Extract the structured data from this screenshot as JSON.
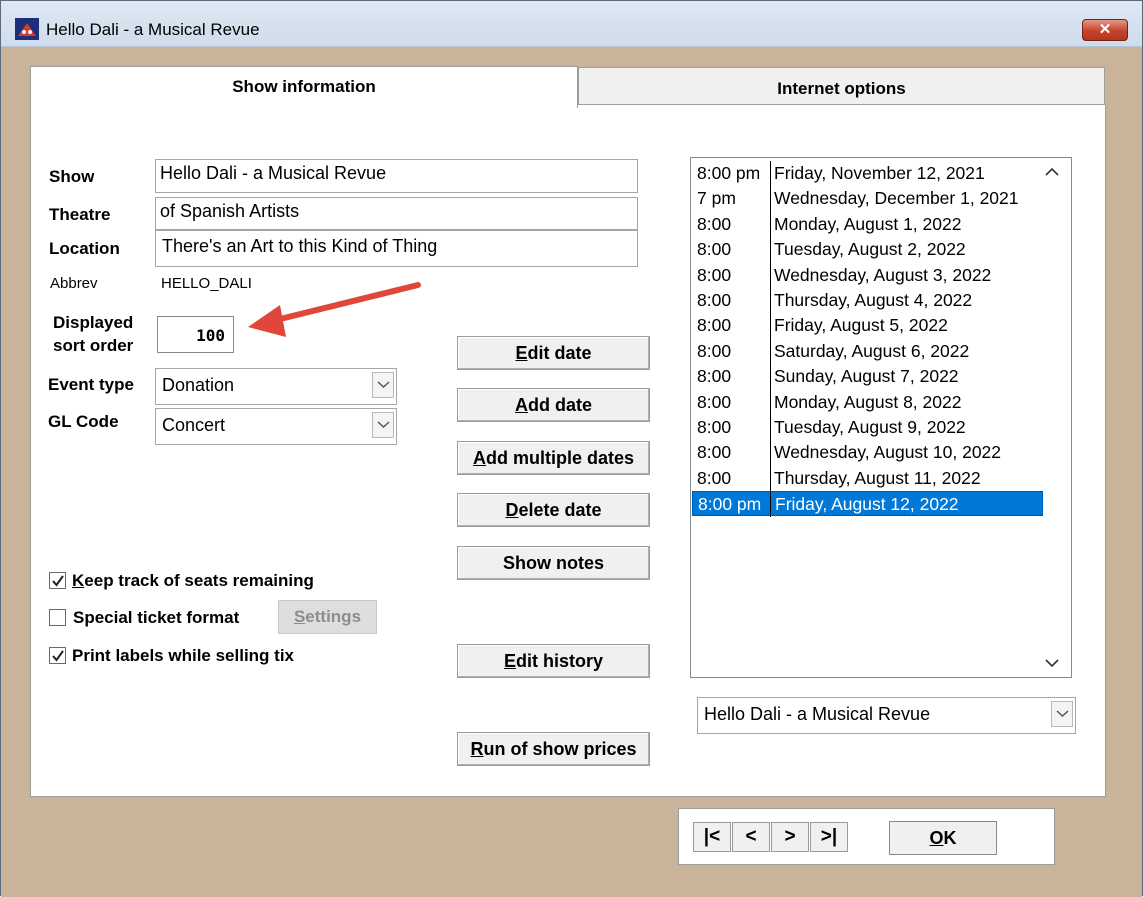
{
  "window": {
    "title": "Hello Dali - a Musical Revue",
    "close_label": "✕"
  },
  "tabs": [
    {
      "label": "Show information",
      "active": true
    },
    {
      "label": "Internet options",
      "active": false
    }
  ],
  "form": {
    "show_label": "Show",
    "show_value": "Hello Dali - a Musical Revue",
    "theatre_label": "Theatre",
    "theatre_value": "of Spanish Artists",
    "location_label": "Location",
    "location_value": "There's an Art to this Kind of Thing",
    "abbrev_label": "Abbrev",
    "abbrev_value": "HELLO_DALI",
    "sort_label_line1": "Displayed",
    "sort_label_line2": "sort order",
    "sort_value": "100",
    "event_type_label": "Event type",
    "event_type_value": "Donation",
    "gl_code_label": "GL Code",
    "gl_code_value": "Concert"
  },
  "buttons": {
    "edit_date": {
      "first": "E",
      "rest": "dit date"
    },
    "add_date": {
      "first": "A",
      "rest": "dd date"
    },
    "add_multiple": {
      "first": "A",
      "rest": "dd multiple dates"
    },
    "delete_date": {
      "first": "D",
      "rest": "elete date"
    },
    "show_notes": "Show notes",
    "edit_history": {
      "first": "E",
      "rest": "dit history"
    },
    "run_prices": {
      "first": "R",
      "rest": "un of show prices"
    },
    "settings": {
      "first": "S",
      "rest": "ettings"
    }
  },
  "checkboxes": [
    {
      "first": "K",
      "rest": "eep track of seats remaining",
      "checked": true
    },
    {
      "first": "",
      "rest": "Special ticket format",
      "checked": false
    },
    {
      "first": "",
      "rest": "Print labels while selling tix",
      "checked": true
    }
  ],
  "dates": [
    {
      "time": "8:00 pm",
      "date": "Friday, November 12, 2021"
    },
    {
      "time": "7 pm",
      "date": "Wednesday, December 1, 2021"
    },
    {
      "time": "8:00",
      "date": "Monday, August 1, 2022"
    },
    {
      "time": "8:00",
      "date": "Tuesday, August 2, 2022"
    },
    {
      "time": "8:00",
      "date": "Wednesday, August 3, 2022"
    },
    {
      "time": "8:00",
      "date": "Thursday, August 4, 2022"
    },
    {
      "time": "8:00",
      "date": "Friday, August 5, 2022"
    },
    {
      "time": "8:00",
      "date": "Saturday, August 6, 2022"
    },
    {
      "time": "8:00",
      "date": "Sunday, August 7, 2022"
    },
    {
      "time": "8:00",
      "date": "Monday, August 8, 2022"
    },
    {
      "time": "8:00",
      "date": "Tuesday, August 9, 2022"
    },
    {
      "time": "8:00",
      "date": "Wednesday, August 10, 2022"
    },
    {
      "time": "8:00",
      "date": "Thursday, August 11, 2022"
    },
    {
      "time": "8:00 pm",
      "date": "Friday, August 12, 2022"
    }
  ],
  "selected_date_index": 13,
  "show_selector_value": "Hello Dali - a Musical Revue",
  "nav": {
    "first": "|<",
    "prev": "<",
    "next": ">",
    "last": ">|",
    "ok_first": "O",
    "ok_rest": "K"
  },
  "colors": {
    "selection": "#0078d7",
    "arrow": "#e0473a",
    "frame": "#c9b39a"
  }
}
